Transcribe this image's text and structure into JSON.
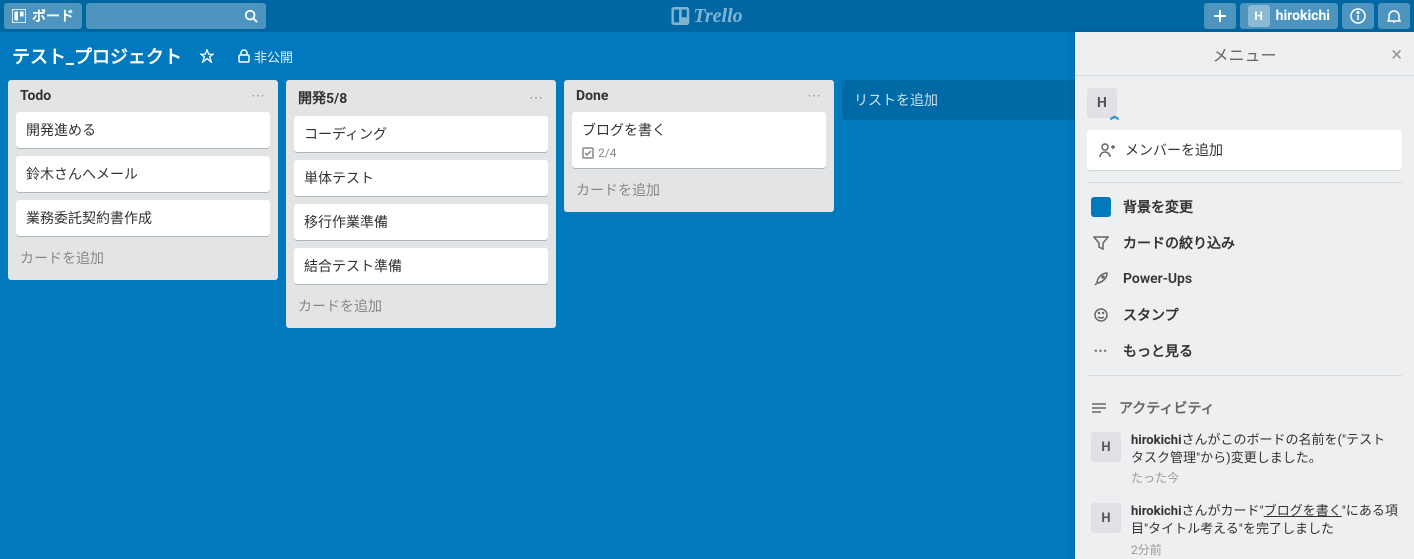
{
  "header": {
    "boards_label": "ボード",
    "logo_text": "Trello",
    "user_initial": "H",
    "user_name": "hirokichi"
  },
  "board": {
    "name": "テスト_プロジェクト",
    "visibility": "非公開",
    "add_list": "リストを追加"
  },
  "lists": [
    {
      "title": "Todo",
      "cards": [
        {
          "text": "開発進める"
        },
        {
          "text": "鈴木さんへメール"
        },
        {
          "text": "業務委託契約書作成"
        }
      ],
      "add_card": "カードを追加"
    },
    {
      "title": "開発5/8",
      "cards": [
        {
          "text": "コーディング"
        },
        {
          "text": "単体テスト"
        },
        {
          "text": "移行作業準備"
        },
        {
          "text": "結合テスト準備"
        }
      ],
      "add_card": "カードを追加"
    },
    {
      "title": "Done",
      "cards": [
        {
          "text": "ブログを書く",
          "checklist": "2/4"
        }
      ],
      "add_card": "カードを追加"
    }
  ],
  "menu": {
    "title": "メニュー",
    "member_initial": "H",
    "add_member": "メンバーを追加",
    "items": {
      "background": "背景を変更",
      "filter": "カードの絞り込み",
      "powerups": "Power-Ups",
      "stickers": "スタンプ",
      "more": "もっと見る"
    },
    "activity_label": "アクティビティ",
    "activities": [
      {
        "initial": "H",
        "user": "hirokichi",
        "text1": "さんがこのボードの名前を(\"テストタスク管理\"から)変更しました。",
        "time": "たった今"
      },
      {
        "initial": "H",
        "user": "hirokichi",
        "text1": "さんがカード\"",
        "link": "ブログを書く",
        "text2": "\"にある項目\"タイトル考える\"を完了しました",
        "time": "2分前"
      }
    ]
  }
}
